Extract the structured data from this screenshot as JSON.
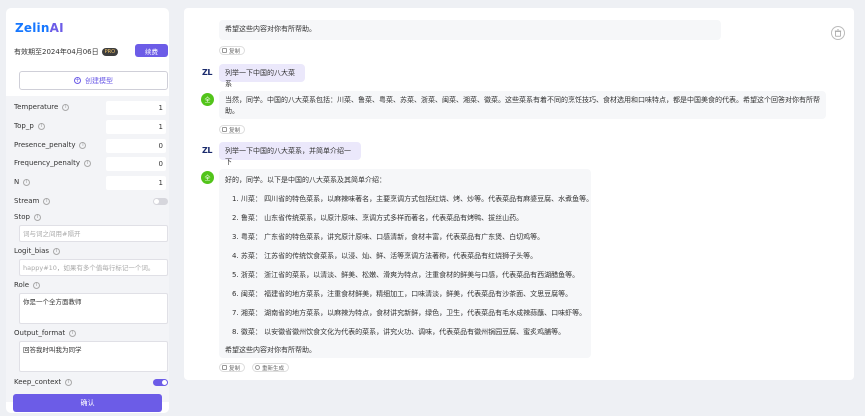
{
  "sidebar": {
    "logo_main": "Zelin",
    "logo_ai": "AI",
    "validity": "有效期至2024年04月06日",
    "pro_badge": "PRO",
    "renew_label": "续费",
    "create_model_label": "创建模型",
    "create_icon": "plus-circle-icon",
    "info_icon_glyph": "i",
    "params": {
      "temperature": {
        "label": "Temperature",
        "value": "1"
      },
      "top_p": {
        "label": "Top_p",
        "value": "1"
      },
      "presence_penalty": {
        "label": "Presence_penalty",
        "value": "0"
      },
      "frequency_penalty": {
        "label": "Frequency_penalty",
        "value": "0"
      },
      "n": {
        "label": "N",
        "value": "1"
      },
      "stream": {
        "label": "Stream",
        "enabled": false
      },
      "stop": {
        "label": "Stop",
        "placeholder": "词与词之间用#隔开"
      },
      "logit_bias": {
        "label": "Logit_bias",
        "placeholder": "happy#10，如果有多个值每行标记一个词。"
      },
      "role": {
        "label": "Role",
        "value": "你是一个全方面教师"
      },
      "output_format": {
        "label": "Output_format",
        "value": "回答我时叫我为同学"
      },
      "keep_context": {
        "label": "Keep_context",
        "enabled": true
      }
    },
    "confirm_label": "确认"
  },
  "chat": {
    "trash_icon": "trash-icon",
    "copy_label": "复制",
    "regenerate_label": "重新生成",
    "user_avatar_text": "ZL",
    "bot_avatar_text": "全",
    "messages": [
      {
        "role": "assistant",
        "text": "希望这些内容对你有所帮助。"
      },
      {
        "role": "user",
        "text": "列举一下中国的八大菜系"
      },
      {
        "role": "assistant",
        "text": "当然，同学。中国的八大菜系包括：川菜、鲁菜、粤菜、苏菜、浙菜、闽菜、湘菜、徽菜。这些菜系有着不同的烹饪技巧、食材选用和口味特点，都是中国美食的代表。希望这个回答对你有所帮助。"
      },
      {
        "role": "user",
        "text": "列举一下中国的八大菜系，并简单介绍一下"
      },
      {
        "role": "assistant",
        "intro": "好的，同学。以下是中国的八大菜系及其简单介绍：",
        "items": [
          "1. 川菜：  四川省的特色菜系，以麻辣味著名，主要烹调方式包括红烧、烤、炒等。代表菜品有麻婆豆腐、水煮鱼等。",
          "2. 鲁菜：  山东省传统菜系，以原汁原味、烹调方式多样而著名，代表菜品有烤鸭、拔丝山药。",
          "3. 粤菜：  广东省的特色菜系，讲究原汁原味、口感清新，食材丰富，代表菜品有广东煲、白切鸡等。",
          "4. 苏菜：  江苏省的传统饮食菜系，以浸、灿、鲜、活等烹调方法著称，代表菜品有红烧狮子头等。",
          "5. 浙菜：  浙江省的菜系，以清淡、鲜美、松嫩、滑爽为特点，注重食材的鲜美与口感，代表菜品有西湖醋鱼等。",
          "6. 闽菜：  福建省的地方菜系，注重食材鲜美，精细加工，口味清淡，鲜美，代表菜品有沙茶面、文思豆腐等。",
          "7. 湘菜：  湖南省的地方菜系，以麻辣为特点，食材讲究新鲜，绿色，卫生，代表菜品有毛水成辣蒜蘸、口味虾等。",
          "8. 徽菜：  以安徽省徽州饮食文化为代表的菜系，讲究火功、调味，代表菜品有徽州锅园豆腐、蜜炙鸡脯等。"
        ],
        "outro": "希望这些内容对你有所帮助。"
      }
    ]
  }
}
